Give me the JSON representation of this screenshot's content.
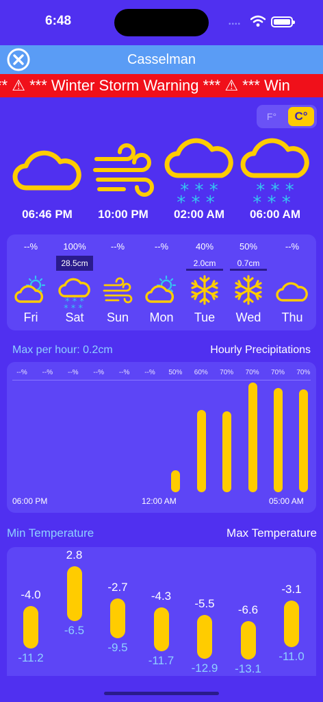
{
  "status_bar": {
    "time": "6:48",
    "signal_dots": "••••"
  },
  "header": {
    "city": "Casselman"
  },
  "warning": {
    "text": "** ⚠ *** Winter Storm Warning *** ⚠ *** Win"
  },
  "units": {
    "f": "F°",
    "c": "C°",
    "selected": "C°"
  },
  "hourly": [
    {
      "time": "06:46 PM",
      "icon": "cloud-icon"
    },
    {
      "time": "10:00 PM",
      "icon": "wind-icon"
    },
    {
      "time": "02:00 AM",
      "icon": "cloud-snow-icon"
    },
    {
      "time": "06:00 AM",
      "icon": "cloud-snow-icon"
    }
  ],
  "daily": [
    {
      "day": "Fri",
      "prob": "--%",
      "snow": "",
      "icon": "partly-cloudy-icon"
    },
    {
      "day": "Sat",
      "prob": "100%",
      "snow": "28.5cm",
      "icon": "cloud-snow-icon"
    },
    {
      "day": "Sun",
      "prob": "--%",
      "snow": "",
      "icon": "wind-icon"
    },
    {
      "day": "Mon",
      "prob": "--%",
      "snow": "",
      "icon": "partly-cloudy-icon"
    },
    {
      "day": "Tue",
      "prob": "40%",
      "snow": "2.0cm",
      "icon": "snowflake-icon"
    },
    {
      "day": "Wed",
      "prob": "50%",
      "snow": "0.7cm",
      "icon": "snowflake-icon"
    },
    {
      "day": "Thu",
      "prob": "--%",
      "snow": "",
      "icon": "cloud-icon"
    }
  ],
  "precipitation": {
    "max_label": "Max per hour: 0.2cm",
    "title": "Hourly Precipitations",
    "time_labels": [
      "06:00 PM",
      "12:00 AM",
      "05:00 AM"
    ],
    "chart_data": {
      "type": "bar",
      "probabilities": [
        "--%",
        "--%",
        "--%",
        "--%",
        "--%",
        "--%",
        "50%",
        "60%",
        "70%",
        "70%",
        "70%",
        "70%"
      ],
      "values": [
        0,
        0,
        0,
        0,
        0,
        0,
        0.04,
        0.15,
        0.148,
        0.2,
        0.19,
        0.187
      ]
    }
  },
  "temperature": {
    "min_title": "Min Temperature",
    "max_title": "Max Temperature",
    "chart_data": {
      "type": "bar",
      "max": [
        -4.0,
        2.8,
        -2.7,
        -4.3,
        -5.5,
        -6.6,
        -3.1
      ],
      "min": [
        -11.2,
        -6.5,
        -9.5,
        -11.7,
        -12.9,
        -13.1,
        -11.0
      ],
      "max_labels": [
        "-4.0",
        "2.8",
        "-2.7",
        "-4.3",
        "-5.5",
        "-6.6",
        "-3.1"
      ],
      "min_labels": [
        "-11.2",
        "-6.5",
        "-9.5",
        "-11.7",
        "-12.9",
        "-13.1",
        "-11.0"
      ]
    }
  },
  "colors": {
    "background": "#5030f0",
    "accent": "#ffcc00",
    "warning": "#f0101a",
    "header": "#5a9cf5",
    "snow": "#35c6f0",
    "sun": "#35c6f0"
  }
}
